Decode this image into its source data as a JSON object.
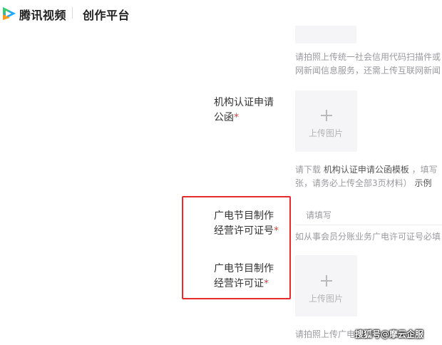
{
  "header": {
    "brand": "腾讯视频",
    "platform": "创作平台"
  },
  "icons": {
    "logo": "tencent-video-logo-icon",
    "plus": "plus-icon"
  },
  "colors": {
    "required": "#e63838",
    "highlight_frame": "#e52b2b",
    "logo_green": "#3cc86e",
    "logo_blue": "#25a5f5",
    "logo_orange": "#ff9a1e"
  },
  "top_hint": {
    "line1": "请拍照上传统一社会信用代码扫描件或",
    "line2": "网新闻信息服务，还需上传互联网新闻"
  },
  "org_letter": {
    "label_line1": "机构认证申请",
    "label_line2": "公函",
    "required_mark": "*",
    "upload_label": "上传图片",
    "hint_line1_prefix": "请下载 ",
    "hint_line1_link": "机构认证申请公函模板",
    "hint_line1_suffix": " ，填写",
    "hint_line2_prefix": "张，请务必上传全部3页材料） ",
    "hint_line2_link": "示例"
  },
  "license_no": {
    "label_line1": "广电节目制作",
    "label_line2": "经营许可证号",
    "required_mark": "*",
    "placeholder": "请填写",
    "hint": "如从事会员分账业务广电许可证号必填"
  },
  "license_img": {
    "label_line1": "广电节目制作",
    "label_line2": "经营许可证",
    "required_mark": "*",
    "upload_label": "上传图片",
    "hint": "请拍照上传广电"
  },
  "watermark": "搜狐号@摩云企服"
}
